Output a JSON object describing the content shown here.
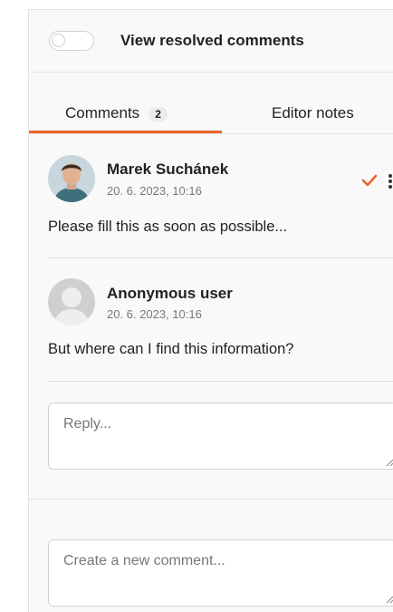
{
  "header": {
    "toggle_label": "View resolved comments",
    "toggle_on": false
  },
  "tabs": [
    {
      "label": "Comments",
      "count": "2",
      "active": true
    },
    {
      "label": "Editor notes",
      "active": false
    }
  ],
  "comments": [
    {
      "author": "Marek Suchánek",
      "date": "20. 6. 2023, 10:16",
      "text": "Please fill this as soon as possible...",
      "avatar": "photo"
    },
    {
      "author": "Anonymous user",
      "date": "20. 6. 2023, 10:16",
      "text": "But where can I find this information?",
      "avatar": "placeholder"
    }
  ],
  "reply": {
    "placeholder": "Reply..."
  },
  "new_comment": {
    "placeholder": "Create a new comment..."
  },
  "colors": {
    "accent": "#e8662b"
  }
}
